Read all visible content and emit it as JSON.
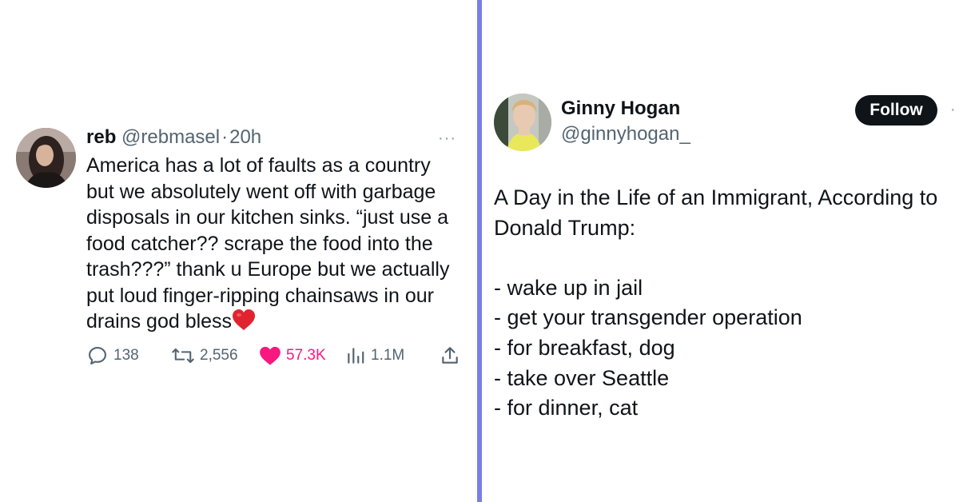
{
  "left_tweet": {
    "name": "reb",
    "handle": "@rebmasel",
    "separator": "·",
    "time": "20h",
    "more": "···",
    "text": "America has a lot of faults as a country\nbut we absolutely went off with garbage\ndisposals in our kitchen sinks. “just use a\nfood catcher?? scrape the food into the\ntrash???” thank u Europe but we actually\nput loud finger-ripping chainsaws in our\ndrains god bless",
    "actions": {
      "replies": "138",
      "reposts": "2,556",
      "likes": "57.3K",
      "views": "1.1M"
    },
    "colors": {
      "like": "#f91880",
      "muted": "#536471"
    }
  },
  "right_tweet": {
    "name": "Ginny Hogan",
    "handle": "@ginnyhogan_",
    "follow_label": "Follow",
    "more": "·",
    "lines": [
      "A Day in the Life of an Immigrant, According to",
      "Donald Trump:",
      "",
      "- wake up in jail",
      "- get your transgender operation",
      "- for breakfast, dog",
      "- take over Seattle",
      "- for dinner, cat"
    ]
  },
  "divider_color": "#7b7ee8"
}
